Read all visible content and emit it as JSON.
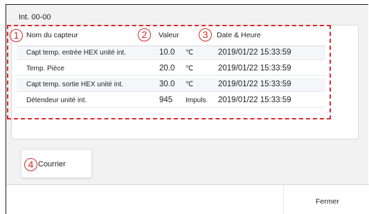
{
  "window": {
    "title": "Int. 00-00"
  },
  "table": {
    "headers": {
      "name": "Nom du capteur",
      "value": "Valeur",
      "datetime": "Date & Heure"
    },
    "rows": [
      {
        "name": "Capt temp. entrée HEX unité int.",
        "value": "10.0",
        "unit": "℃",
        "datetime": "2019/01/22 15:33:59"
      },
      {
        "name": "Temp. Pièce",
        "value": "20.0",
        "unit": "℃",
        "datetime": "2019/01/22 15:33:59"
      },
      {
        "name": "Capt temp. sortie HEX unité int.",
        "value": "30.0",
        "unit": "℃",
        "datetime": "2019/01/22 15:33:59"
      },
      {
        "name": "Détendeur unité int.",
        "value": "945",
        "unit": "Impuls.",
        "datetime": "2019/01/22 15:33:59"
      }
    ]
  },
  "callouts": [
    "1",
    "2",
    "3",
    "4"
  ],
  "buttons": {
    "mail": "Courrier",
    "close": "Fermer"
  },
  "colors": {
    "callout": "#d9241e",
    "highlight_border": "#e0242a",
    "row_alt": "#f4f6f9"
  }
}
